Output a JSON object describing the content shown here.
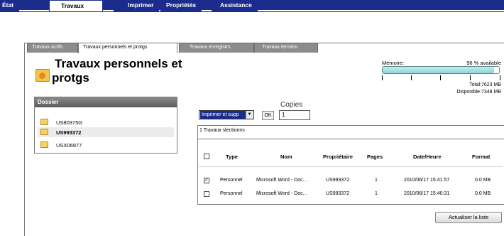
{
  "top_tabs": [
    {
      "label": "État"
    },
    {
      "label": "Travaux"
    },
    {
      "label": "Imprimer"
    },
    {
      "label": "Propriétés"
    },
    {
      "label": "Assistance"
    }
  ],
  "sub_tabs": [
    {
      "label": "Travaux actifs"
    },
    {
      "label": "Travaux personnels et protgs"
    },
    {
      "label": "Travaux enregistrs"
    },
    {
      "label": "Travaux termins"
    }
  ],
  "page": {
    "title_line1": "Travaux personnels et",
    "title_line2": "protgs"
  },
  "dossier": {
    "header": "Dossier",
    "items": [
      {
        "label": "US80375G"
      },
      {
        "label": "US993372"
      },
      {
        "label": "USX06977"
      }
    ]
  },
  "memory": {
    "label": "Mémoire:",
    "percent_text": "96 % available",
    "fill_fraction": 0.96,
    "total_text": "Total:7623 MB",
    "available_text": "Disponible:7348 MB"
  },
  "actions": {
    "select_value": "Imprimer et supp",
    "ok_label": "OK",
    "copies_label": "Copies",
    "copies_value": "1"
  },
  "jobs": {
    "selected_text": "1 Travaux slectionns",
    "columns": [
      "Type",
      "Nom",
      "Propriétaire",
      "Pages",
      "Date/Heure",
      "Format"
    ],
    "rows": [
      {
        "checked": "✓",
        "type": "Personnel",
        "name": "Microsoft Word - Doc...",
        "owner": "US993372",
        "pages": "1",
        "datetime": "2010/06/17 15:41:57",
        "format": "0.0 MB"
      },
      {
        "checked": "",
        "type": "Personnel",
        "name": "Microsoft Word - Doc...",
        "owner": "US993372",
        "pages": "1",
        "datetime": "2010/06/17 15:40:31",
        "format": "0.0 MB"
      }
    ]
  },
  "refresh_label": "Actualiser la liste",
  "colors": {
    "navy": "#1b2c8c",
    "gauge_fill": "#8dd3d6",
    "selection": "#1b2c8c"
  }
}
